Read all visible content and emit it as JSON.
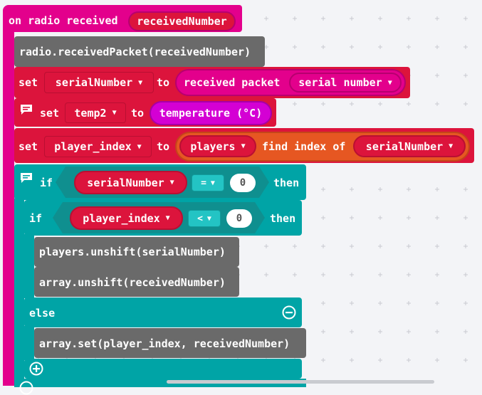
{
  "colors": {
    "radio": "#e3008c",
    "radio_dark": "#b7006f",
    "gray": "#6a6a6a",
    "variables": "#dc143c",
    "variables_dark": "#ba0f32",
    "input": "#d400d4",
    "arrays": "#e65722",
    "logic": "#00a4a6",
    "logic_dark": "#0f8f8f"
  },
  "event": {
    "label": "on radio received",
    "param": "receivedNumber"
  },
  "block_radio_packet": {
    "code": "radio.receivedPacket(receivedNumber)"
  },
  "block_set_serial": {
    "set": "set",
    "var": "serialNumber",
    "to": "to",
    "value_label": "received packet",
    "value_option": "serial number"
  },
  "block_set_temp": {
    "set": "set",
    "var": "temp2",
    "to": "to",
    "value": "temperature (°C)"
  },
  "block_set_index": {
    "set": "set",
    "var": "player_index",
    "to": "to",
    "array": "players",
    "find": "find index of",
    "arg": "serialNumber"
  },
  "if_outer": {
    "if": "if",
    "left": "serialNumber",
    "op": "=",
    "right": "0",
    "then": "then"
  },
  "if_inner": {
    "if": "if",
    "left": "player_index",
    "op": "<",
    "right": "0",
    "then": "then",
    "else": "else"
  },
  "stmt_unshift_players": {
    "code": "players.unshift(serialNumber)"
  },
  "stmt_unshift_array": {
    "code": "array.unshift(receivedNumber)"
  },
  "stmt_array_set": {
    "code": "array.set(player_index, receivedNumber)"
  },
  "icons": {
    "comment": "comment-icon",
    "dropdown": "caret-down-icon",
    "remove_else": "minus-circle-icon",
    "add_else": "plus-circle-icon"
  }
}
